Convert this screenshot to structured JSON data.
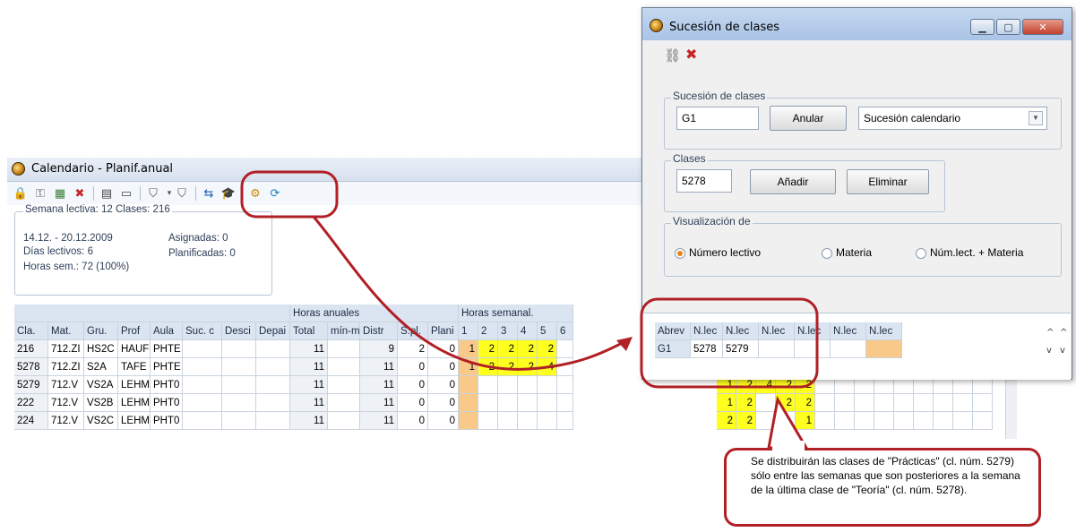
{
  "main_window": {
    "title": "Calendario - Planif.anual",
    "info": {
      "header": "Semana lectiva: 12  Clases: 216",
      "dates": "14.12. - 20.12.2009",
      "days": "Días lectivos: 6",
      "hours": "Horas sem.: 72 (100%)",
      "assigned": "Asignadas: 0",
      "planned": "Planificadas: 0"
    },
    "group_headers": {
      "annual": "Horas anuales",
      "weekly": "Horas semanal."
    },
    "columns": [
      "Cla.",
      "Mat.",
      "Gru.",
      "Prof",
      "Aula",
      "Suc. c",
      "Desci",
      "Depai",
      "Total",
      "mín-m",
      "Distr",
      "S.pl.",
      "Plani",
      "1",
      "2",
      "3",
      "4",
      "5",
      "6"
    ],
    "rows": [
      {
        "cla": "216",
        "mat": "712.ZI",
        "gru": "HS2C",
        "prof": "HAUF",
        "aula": "PHTE",
        "total": "11",
        "distr": "9",
        "spl": "2",
        "plani": "0",
        "w": [
          "1",
          "2",
          "2",
          "2",
          "2",
          ""
        ]
      },
      {
        "cla": "5278",
        "mat": "712.ZI",
        "gru": "S2A",
        "prof": "TAFE",
        "aula": "PHTE",
        "total": "11",
        "distr": "11",
        "spl": "0",
        "plani": "0",
        "w": [
          "1",
          "2",
          "2",
          "2",
          "4",
          ""
        ]
      },
      {
        "cla": "5279",
        "mat": "712.V",
        "gru": "VS2A",
        "prof": "LEHM",
        "aula": "PHT0",
        "total": "11",
        "distr": "11",
        "spl": "0",
        "plani": "0",
        "w": [
          "",
          "",
          "",
          "",
          "",
          ""
        ]
      },
      {
        "cla": "222",
        "mat": "712.V",
        "gru": "VS2B",
        "prof": "LEHM",
        "aula": "PHT0",
        "total": "11",
        "distr": "11",
        "spl": "0",
        "plani": "0",
        "w": [
          "",
          "",
          "",
          "",
          "",
          ""
        ]
      },
      {
        "cla": "224",
        "mat": "712.V",
        "gru": "VS2C",
        "prof": "LEHM",
        "aula": "PHT0",
        "total": "11",
        "distr": "11",
        "spl": "0",
        "plani": "0",
        "w": [
          "",
          "",
          "",
          "",
          "",
          ""
        ]
      }
    ],
    "extra_week_values": [
      [
        "1",
        "2",
        "4",
        "2",
        "2"
      ],
      [
        "1",
        "2",
        "",
        "2",
        "2"
      ],
      [
        "2",
        "2",
        "",
        "",
        "1"
      ]
    ]
  },
  "dialog": {
    "title": "Sucesión de clases",
    "suc_group_label": "Sucesión de clases",
    "suc_value": "G1",
    "anular_label": "Anular",
    "suc_type": "Sucesión calendario",
    "clases_label": "Clases",
    "clases_value": "5278",
    "anadir_label": "Añadir",
    "eliminar_label": "Eliminar",
    "vis_label": "Visualización de",
    "radio_options": [
      "Número lectivo",
      "Materia",
      "Núm.lect. + Materia"
    ],
    "table_headers": [
      "Abrev",
      "N.lec",
      "N.lec",
      "N.lec",
      "N.lec",
      "N.lec",
      "N.lec"
    ],
    "table_row": [
      "G1",
      "5278",
      "5279",
      "",
      "",
      "",
      ""
    ]
  },
  "callout": {
    "text": "Se distribuirán las clases de \"Prácticas\" (cl. núm. 5279) sólo entre las semanas que son  posteriores a la semana de la última clase de \"Teoría\" (cl. núm. 5278)."
  },
  "colors": {
    "annotation_red": "#b12026",
    "highlight_yellow": "#ffff1f",
    "highlight_orange": "#f9c98a",
    "header_blue": "#dbe5f1"
  }
}
